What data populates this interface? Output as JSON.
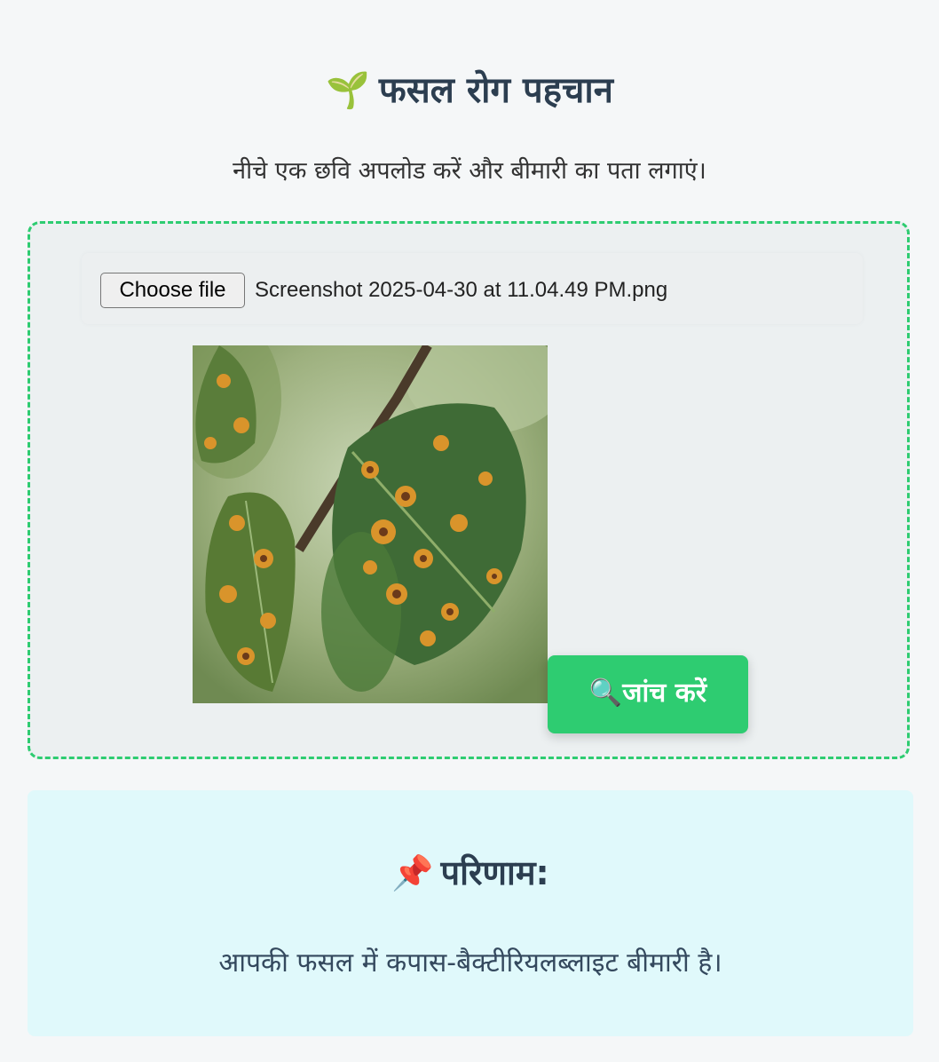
{
  "header": {
    "icon": "seedling-icon",
    "icon_glyph": "🌱",
    "title": "फसल रोग पहचान",
    "subtitle": "नीचे एक छवि अपलोड करें और बीमारी का पता लगाएं।"
  },
  "upload": {
    "choose_label": "Choose file",
    "file_name": "Screenshot 2025-04-30 at 11.04.49 PM.png",
    "check_icon": "magnifier-icon",
    "check_icon_glyph": "🔍",
    "check_label": "जांच करें"
  },
  "result": {
    "icon": "pushpin-icon",
    "icon_glyph": "📌",
    "title": "परिणाम:",
    "text": "आपकी फसल में कपास-बैक्टीरियलब्लाइट बीमारी है।"
  },
  "colors": {
    "accent": "#2ecc71",
    "title": "#2c3e50",
    "upload_bg": "#ecf0f1",
    "result_bg": "#e0f9fb"
  }
}
